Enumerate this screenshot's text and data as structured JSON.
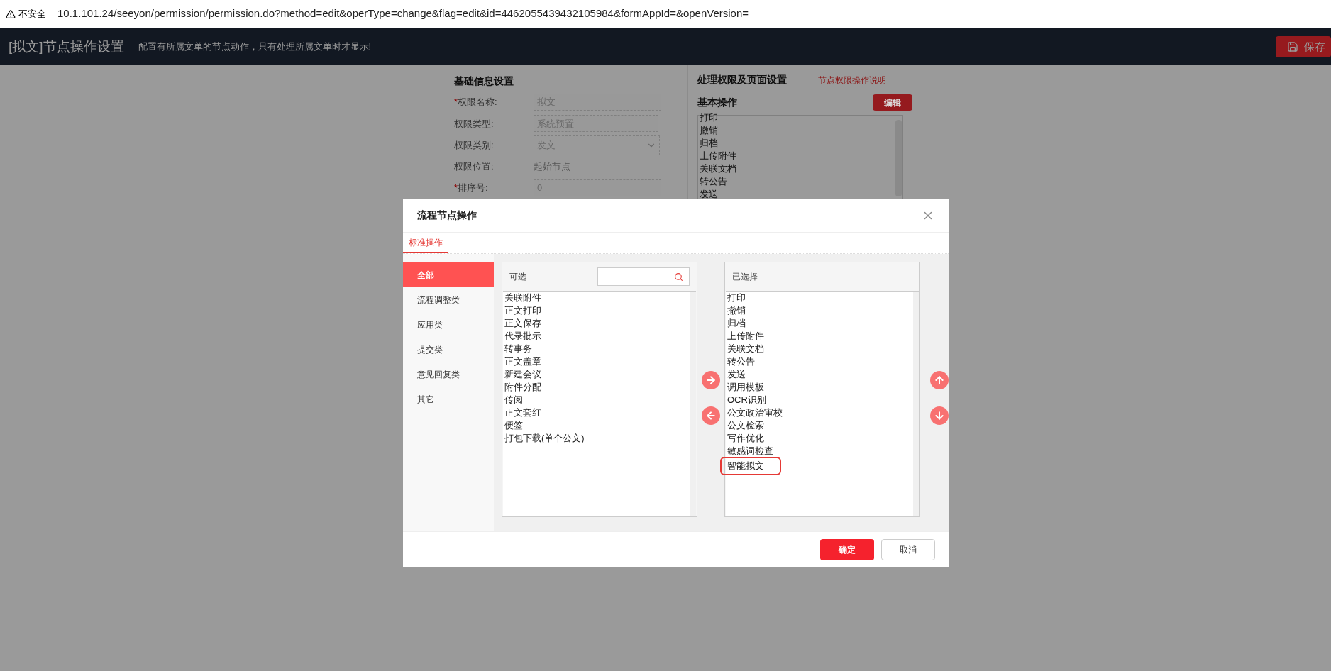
{
  "browser": {
    "security": "不安全",
    "url": "10.1.101.24/seeyon/permission/permission.do?method=edit&operType=change&flag=edit&id=4462055439432105984&formAppId=&openVersion="
  },
  "header": {
    "title": "[拟文]节点操作设置",
    "subtitle": "配置有所属文单的节点动作，只有处理所属文单时才显示!",
    "save_button": "保存"
  },
  "basic_info": {
    "title": "基础信息设置",
    "fields": [
      {
        "required_mark": "*",
        "label": "权限名称:",
        "kind": "input",
        "value": "拟文"
      },
      {
        "label": "权限类型:",
        "kind": "input",
        "value": "系统预置"
      },
      {
        "label": "权限类别:",
        "kind": "select",
        "value": "发文"
      },
      {
        "label": "权限位置:",
        "kind": "text",
        "value": "起始节点"
      },
      {
        "required_mark": "*",
        "label": "排序号:",
        "kind": "input",
        "value": "0"
      }
    ]
  },
  "permissions": {
    "title": "处理权限及页面设置",
    "help_link": "节点权限操作说明",
    "basic_ops_title": "基本操作",
    "edit_button": "编辑",
    "basic_ops": [
      "打印",
      "撤销",
      "归档",
      "上传附件",
      "关联文档",
      "转公告",
      "发送"
    ]
  },
  "dialog": {
    "title": "流程节点操作",
    "tabs": [
      {
        "label": "标准操作",
        "selected": true
      }
    ],
    "categories": [
      {
        "label": "全部",
        "selected": true
      },
      {
        "label": "流程调整类",
        "selected": false
      },
      {
        "label": "应用类",
        "selected": false
      },
      {
        "label": "提交类",
        "selected": false
      },
      {
        "label": "意见回复类",
        "selected": false
      },
      {
        "label": "其它",
        "selected": false
      }
    ],
    "available": {
      "title": "可选",
      "items": [
        "关联附件",
        "正文打印",
        "正文保存",
        "代录批示",
        "转事务",
        "正文盖章",
        "新建会议",
        "附件分配",
        "传阅",
        "正文套红",
        "便签",
        "打包下载(单个公文)"
      ]
    },
    "selected_list": {
      "title": "已选择",
      "items": [
        {
          "label": "打印",
          "highlighted": false
        },
        {
          "label": "撤销",
          "highlighted": false
        },
        {
          "label": "归档",
          "highlighted": false
        },
        {
          "label": "上传附件",
          "highlighted": false
        },
        {
          "label": "关联文档",
          "highlighted": false
        },
        {
          "label": "转公告",
          "highlighted": false
        },
        {
          "label": "发送",
          "highlighted": false
        },
        {
          "label": "调用模板",
          "highlighted": false
        },
        {
          "label": "OCR识别",
          "highlighted": false
        },
        {
          "label": "公文政治审校",
          "highlighted": false
        },
        {
          "label": "公文检索",
          "highlighted": false
        },
        {
          "label": "写作优化",
          "highlighted": false
        },
        {
          "label": "敏感词检查",
          "highlighted": false
        },
        {
          "label": "智能拟文",
          "highlighted": true
        }
      ]
    },
    "confirm_button": "确定",
    "cancel_button": "取消"
  }
}
